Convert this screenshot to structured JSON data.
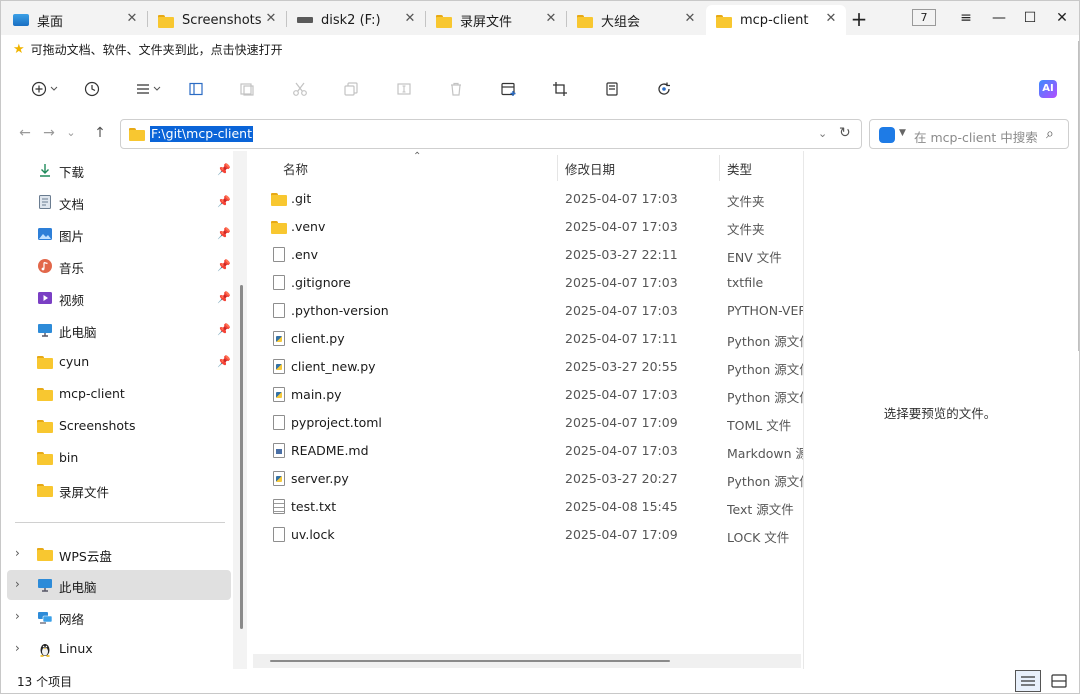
{
  "tabs": [
    {
      "label": "桌面",
      "icon": "desktop-icon"
    },
    {
      "label": "Screenshots",
      "icon": "folder-icon"
    },
    {
      "label": "disk2 (F:)",
      "icon": "drive-icon"
    },
    {
      "label": "录屏文件",
      "icon": "folder-icon"
    },
    {
      "label": "大组会",
      "icon": "folder-icon"
    },
    {
      "label": "mcp-client",
      "icon": "folder-icon",
      "active": true
    }
  ],
  "tab_count": "7",
  "favorites_hint": "可拖动文档、软件、文件夹到此，点击快速打开",
  "address": {
    "path": "F:\\git\\mcp-client"
  },
  "search": {
    "placeholder": "在 mcp-client 中搜索"
  },
  "sidebar": {
    "quick": [
      {
        "label": "下载",
        "icon": "download-icon",
        "pinned": true
      },
      {
        "label": "文档",
        "icon": "documents-icon",
        "pinned": true
      },
      {
        "label": "图片",
        "icon": "pictures-icon",
        "pinned": true
      },
      {
        "label": "音乐",
        "icon": "music-icon",
        "pinned": true
      },
      {
        "label": "视频",
        "icon": "videos-icon",
        "pinned": true
      },
      {
        "label": "此电脑",
        "icon": "computer-icon",
        "pinned": true
      },
      {
        "label": "cyun",
        "icon": "folder-icon",
        "pinned": true
      },
      {
        "label": "mcp-client",
        "icon": "folder-icon",
        "pinned": false
      },
      {
        "label": "Screenshots",
        "icon": "folder-icon",
        "pinned": false
      },
      {
        "label": "bin",
        "icon": "folder-icon",
        "pinned": false
      },
      {
        "label": "录屏文件",
        "icon": "folder-icon",
        "pinned": false
      }
    ],
    "tree": [
      {
        "label": "WPS云盘",
        "icon": "folder-icon"
      },
      {
        "label": "此电脑",
        "icon": "computer-icon",
        "selected": true
      },
      {
        "label": "网络",
        "icon": "network-icon"
      },
      {
        "label": "Linux",
        "icon": "linux-icon"
      }
    ]
  },
  "columns": {
    "name": "名称",
    "date": "修改日期",
    "type": "类型"
  },
  "files": [
    {
      "name": ".git",
      "date": "2025-04-07 17:03",
      "type": "文件夹",
      "icon": "folder"
    },
    {
      "name": ".venv",
      "date": "2025-04-07 17:03",
      "type": "文件夹",
      "icon": "folder"
    },
    {
      "name": ".env",
      "date": "2025-03-27 22:11",
      "type": "ENV 文件",
      "icon": "doc"
    },
    {
      "name": ".gitignore",
      "date": "2025-04-07 17:03",
      "type": "txtfile",
      "icon": "doc"
    },
    {
      "name": ".python-version",
      "date": "2025-04-07 17:03",
      "type": "PYTHON-VER",
      "icon": "doc"
    },
    {
      "name": "client.py",
      "date": "2025-04-07 17:11",
      "type": "Python 源文件",
      "icon": "py"
    },
    {
      "name": "client_new.py",
      "date": "2025-03-27 20:55",
      "type": "Python 源文件",
      "icon": "py"
    },
    {
      "name": "main.py",
      "date": "2025-04-07 17:03",
      "type": "Python 源文件",
      "icon": "py"
    },
    {
      "name": "pyproject.toml",
      "date": "2025-04-07 17:09",
      "type": "TOML 文件",
      "icon": "doc"
    },
    {
      "name": "README.md",
      "date": "2025-04-07 17:03",
      "type": "Markdown 源",
      "icon": "md"
    },
    {
      "name": "server.py",
      "date": "2025-03-27 20:27",
      "type": "Python 源文件",
      "icon": "py"
    },
    {
      "name": "test.txt",
      "date": "2025-04-08 15:45",
      "type": "Text 源文件",
      "icon": "txt"
    },
    {
      "name": "uv.lock",
      "date": "2025-04-07 17:09",
      "type": "LOCK 文件",
      "icon": "doc"
    }
  ],
  "preview": {
    "message": "选择要预览的文件。"
  },
  "status": {
    "count": "13 个项目"
  }
}
